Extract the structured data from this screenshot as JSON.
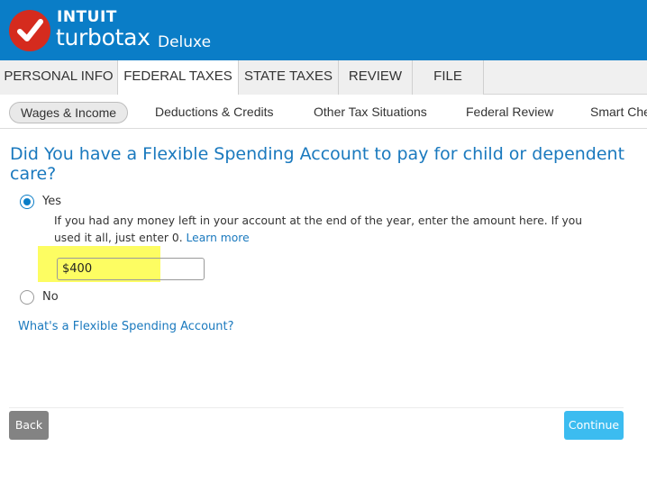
{
  "header": {
    "brand_top": "INTUIT",
    "brand_product": "turbotax",
    "brand_edition": "Deluxe",
    "logo_icon": "red-check-circle-icon",
    "brand_color": "#0a7dc7"
  },
  "main_tabs": [
    {
      "label": "PERSONAL INFO",
      "active": false
    },
    {
      "label": "FEDERAL TAXES",
      "active": true
    },
    {
      "label": "STATE TAXES",
      "active": false
    },
    {
      "label": "REVIEW",
      "active": false
    },
    {
      "label": "FILE",
      "active": false
    }
  ],
  "sub_tabs": [
    {
      "label": "Wages & Income",
      "active": true
    },
    {
      "label": "Deductions & Credits",
      "active": false
    },
    {
      "label": "Other Tax Situations",
      "active": false
    },
    {
      "label": "Federal Review",
      "active": false
    },
    {
      "label": "Smart Che",
      "active": false
    }
  ],
  "question": {
    "title": "Did You have a Flexible Spending Account to pay for child or dependent care?",
    "options": [
      {
        "label": "Yes",
        "selected": true
      },
      {
        "label": "No",
        "selected": false
      }
    ],
    "help_text": "If you had any money left in your account at the end of the year, enter the amount here. If you used it all, just enter 0.",
    "learn_more": "Learn more",
    "amount_value": "$400",
    "fsa_link": "What's a Flexible Spending Account?"
  },
  "footer": {
    "back_label": "Back",
    "continue_label": "Continue"
  }
}
